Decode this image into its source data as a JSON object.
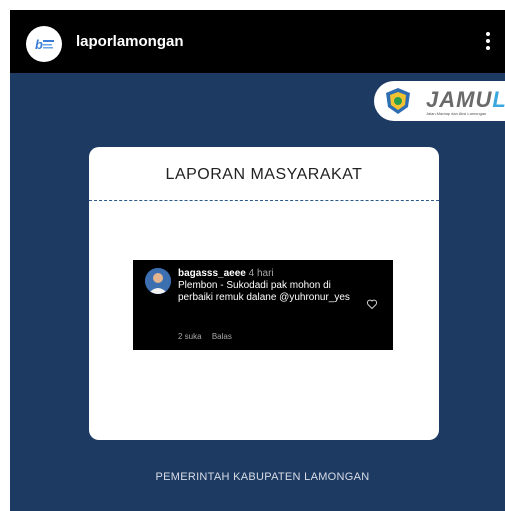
{
  "topbar": {
    "username": "laporlamongan",
    "avatar_icon": "laporlamongan-logo-icon",
    "more_icon": "more-vertical-icon"
  },
  "brand_pill": {
    "brand_main": "JAMU",
    "brand_accent": "LA",
    "tagline": "Jalan Mantap dan Aksi Lamongan",
    "seal_icon": "government-seal-icon",
    "accent_color": "#3aa7de"
  },
  "card": {
    "title": "LAPORAN MASYARAKAT"
  },
  "comment": {
    "username": "bagasss_aeee",
    "time": "4 hari",
    "text": "Plembon - Sukodadi pak mohon di perbaiki remuk dalane @yuhronur_yes",
    "likes": "2 suka",
    "reply": "Balas",
    "heart_icon": "heart-outline-icon"
  },
  "footer": {
    "text": "PEMERINTAH KABUPATEN LAMONGAN"
  },
  "colors": {
    "background": "#1d3a63",
    "topbar": "#000000"
  }
}
